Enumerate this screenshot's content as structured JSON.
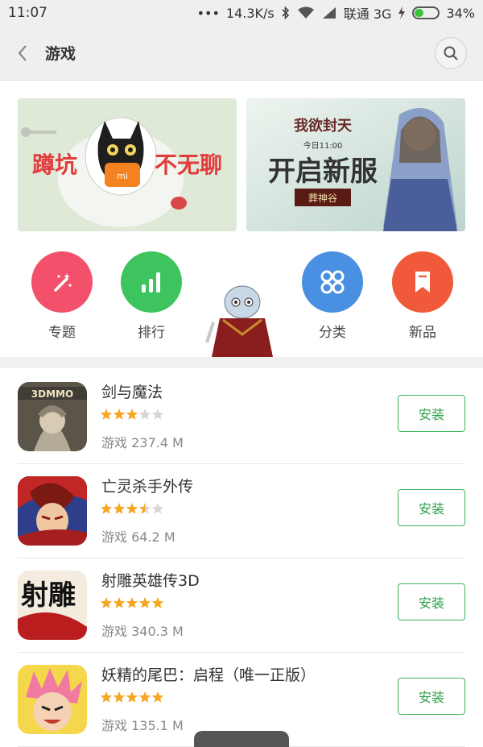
{
  "status_bar": {
    "time": "11:07",
    "dots": "•••",
    "speed": "14.3K/s",
    "carrier": "联通 3G",
    "battery": "34%",
    "battery_level": 0.34
  },
  "header": {
    "title": "游戏",
    "icons": {
      "back": "chevron-left-icon",
      "search": "search-icon"
    }
  },
  "banners": [
    {
      "id": "banner-1",
      "text_left": "蹲坑",
      "text_right": "不无聊",
      "badge": "mi"
    },
    {
      "id": "banner-2",
      "logo": "我欲封天",
      "subtitle": "今日11:00",
      "headline": "开启新服",
      "server": "葬神谷"
    }
  ],
  "shortcuts": [
    {
      "label": "专题",
      "icon": "magic-wand-icon",
      "color": "#f2506b"
    },
    {
      "label": "排行",
      "icon": "bar-chart-icon",
      "color": "#3ec45f"
    },
    {
      "label": "分类",
      "icon": "grid-circles-icon",
      "color": "#4a90e2"
    },
    {
      "label": "新品",
      "icon": "bookmark-icon",
      "color": "#f05a3a"
    }
  ],
  "apps": [
    {
      "name": "剑与魔法",
      "icon_label": "3DMMO",
      "rating": 3,
      "category": "游戏",
      "size": "237.4 M",
      "install_label": "安装"
    },
    {
      "name": "亡灵杀手外传",
      "icon_label": "",
      "rating": 3.5,
      "category": "游戏",
      "size": "64.2 M",
      "install_label": "安装"
    },
    {
      "name": "射雕英雄传3D",
      "icon_label": "射雕",
      "rating": 5,
      "category": "游戏",
      "size": "340.3 M",
      "install_label": "安装"
    },
    {
      "name": "妖精的尾巴：启程（唯一正版）",
      "icon_label": "",
      "rating": 5,
      "category": "游戏",
      "size": "135.1 M",
      "install_label": "安装"
    }
  ],
  "colors": {
    "accent_green": "#3fb55d",
    "star": "#f5a623",
    "star_empty": "#d6d6d6"
  }
}
